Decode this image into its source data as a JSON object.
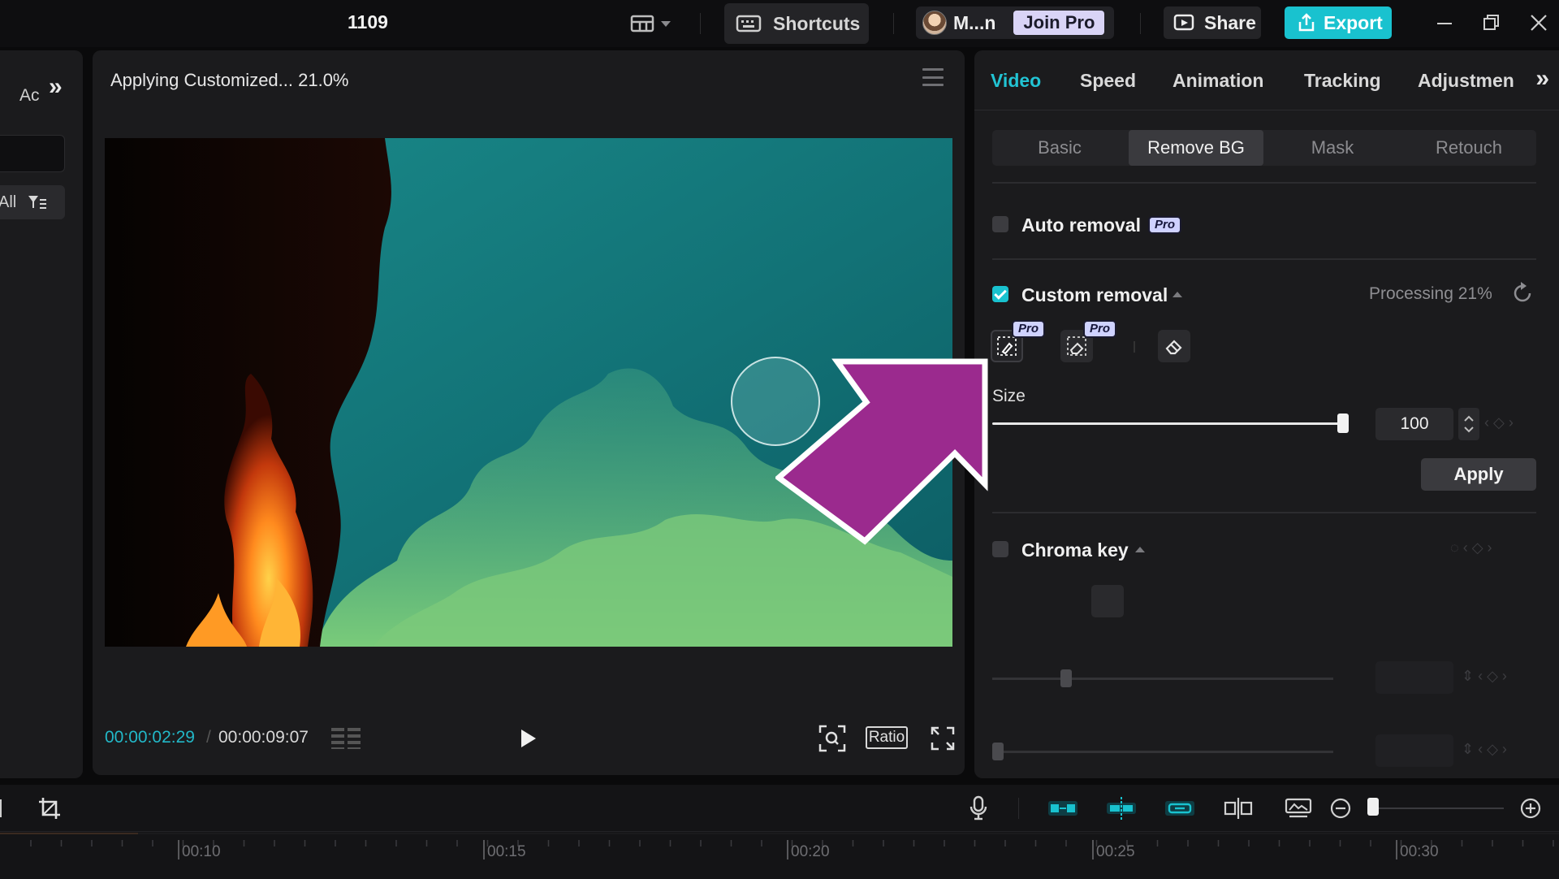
{
  "topbar": {
    "project_title": "1109",
    "shortcuts_label": "Shortcuts",
    "user_name": "M...n",
    "join_pro_label": "Join Pro",
    "share_label": "Share",
    "export_label": "Export"
  },
  "left_panel": {
    "label": "Ac",
    "filter_label": "All"
  },
  "player": {
    "status_text": "Applying Customized... 21.0%",
    "current_time": "00:00:02:29",
    "total_time": "00:00:09:07",
    "ratio_label": "Ratio"
  },
  "inspector": {
    "tabs": [
      "Video",
      "Speed",
      "Animation",
      "Tracking",
      "Adjustmen"
    ],
    "active_tab": "Video",
    "subtabs": [
      "Basic",
      "Remove BG",
      "Mask",
      "Retouch"
    ],
    "active_subtab": "Remove BG",
    "auto_removal": {
      "label": "Auto removal",
      "badge": "Pro",
      "checked": false
    },
    "custom_removal": {
      "label": "Custom removal",
      "checked": true,
      "status": "Processing 21%",
      "tool_badges": [
        "Pro",
        "Pro"
      ],
      "size_label": "Size",
      "size_value": "100",
      "size_level": 1.0,
      "apply_label": "Apply"
    },
    "chroma_key": {
      "label": "Chroma key",
      "checked": false
    }
  },
  "timeline": {
    "ruler_labels": [
      "00:10",
      "00:15",
      "00:20",
      "00:25",
      "00:30"
    ]
  },
  "colors": {
    "accent": "#19c2cf",
    "annotation_arrow": "#9b2a8e",
    "panel_bg": "#1b1b1d"
  }
}
